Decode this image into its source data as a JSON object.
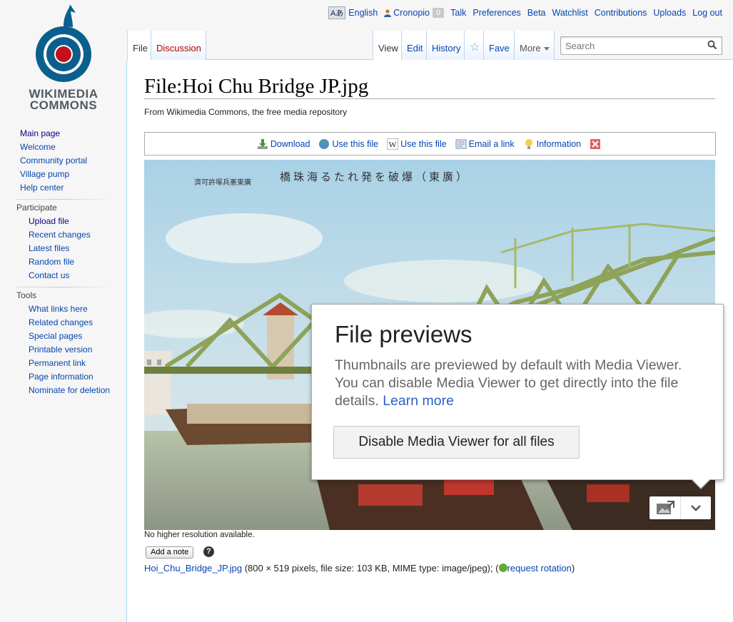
{
  "logo": {
    "line1": "WIKIMEDIA",
    "line2": "COMMONS"
  },
  "personal": {
    "language_icon": "Aあ",
    "language": "English",
    "username": "Cronopio",
    "notifications": "0",
    "talk": "Talk",
    "preferences": "Preferences",
    "beta": "Beta",
    "watchlist": "Watchlist",
    "contributions": "Contributions",
    "uploads": "Uploads",
    "logout": "Log out"
  },
  "sidebar": {
    "main": [
      "Main page",
      "Welcome",
      "Community portal",
      "Village pump",
      "Help center"
    ],
    "participate": {
      "heading": "Participate",
      "items": [
        "Upload file",
        "Recent changes",
        "Latest files",
        "Random file",
        "Contact us"
      ]
    },
    "tools": {
      "heading": "Tools",
      "items": [
        "What links here",
        "Related changes",
        "Special pages",
        "Printable version",
        "Permanent link",
        "Page information",
        "Nominate for deletion"
      ]
    }
  },
  "tabs": {
    "file": "File",
    "discussion": "Discussion",
    "view": "View",
    "edit": "Edit",
    "history": "History",
    "watch_icon": "☆",
    "fave": "Fave",
    "more": "More"
  },
  "search": {
    "placeholder": "Search"
  },
  "page": {
    "title": "File:Hoi Chu Bridge JP.jpg",
    "tagline": "From Wikimedia Commons, the free media repository"
  },
  "toolbar": {
    "download": "Download",
    "use_this_file_1": "Use this file",
    "use_this_file_2": "Use this file",
    "email": "Email a link",
    "information": "Information"
  },
  "image": {
    "caption_text": "橋珠海るたれ発を破爆（東廣）",
    "caption_text2": "濟可許塚兵憲東廣"
  },
  "file": {
    "no_higher_res": "No higher resolution available.",
    "add_note": "Add a note",
    "help_symbol": "?",
    "filename": "Hoi_Chu_Bridge_JP.jpg",
    "details": " (800 × 519 pixels, file size: 103 KB, MIME type: image/jpeg); (",
    "request_rotation": "request rotation",
    "close_paren": ")"
  },
  "popup": {
    "title": "File previews",
    "body": "Thumbnails are previewed by default with Media Viewer. You can disable Media Viewer to get directly into the file details. ",
    "learn_more": "Learn more",
    "button": "Disable Media Viewer for all files"
  },
  "colors": {
    "link": "#0645ad",
    "new_link": "#ba0000",
    "sidebar_bg": "#f6f6f6",
    "border_blue": "#a7d7f9"
  }
}
